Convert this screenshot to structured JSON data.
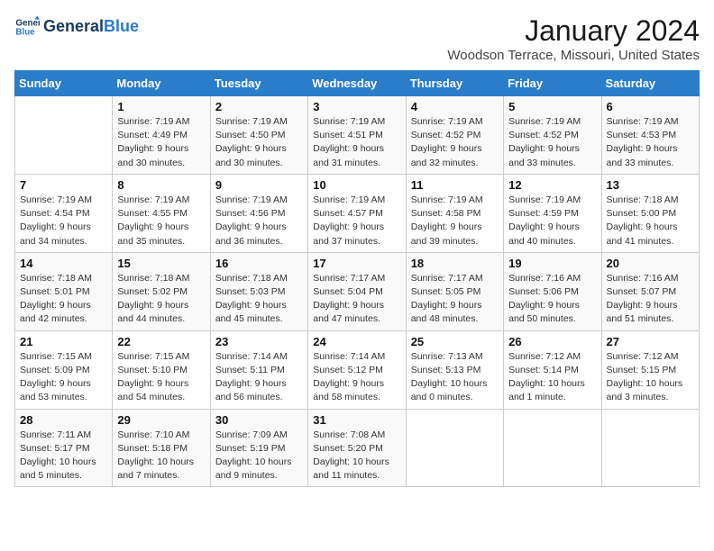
{
  "logo": {
    "text_general": "General",
    "text_blue": "Blue"
  },
  "header": {
    "title": "January 2024",
    "subtitle": "Woodson Terrace, Missouri, United States"
  },
  "columns": [
    "Sunday",
    "Monday",
    "Tuesday",
    "Wednesday",
    "Thursday",
    "Friday",
    "Saturday"
  ],
  "weeks": [
    [
      {
        "day": "",
        "info": ""
      },
      {
        "day": "1",
        "info": "Sunrise: 7:19 AM\nSunset: 4:49 PM\nDaylight: 9 hours\nand 30 minutes."
      },
      {
        "day": "2",
        "info": "Sunrise: 7:19 AM\nSunset: 4:50 PM\nDaylight: 9 hours\nand 30 minutes."
      },
      {
        "day": "3",
        "info": "Sunrise: 7:19 AM\nSunset: 4:51 PM\nDaylight: 9 hours\nand 31 minutes."
      },
      {
        "day": "4",
        "info": "Sunrise: 7:19 AM\nSunset: 4:52 PM\nDaylight: 9 hours\nand 32 minutes."
      },
      {
        "day": "5",
        "info": "Sunrise: 7:19 AM\nSunset: 4:52 PM\nDaylight: 9 hours\nand 33 minutes."
      },
      {
        "day": "6",
        "info": "Sunrise: 7:19 AM\nSunset: 4:53 PM\nDaylight: 9 hours\nand 33 minutes."
      }
    ],
    [
      {
        "day": "7",
        "info": "Sunrise: 7:19 AM\nSunset: 4:54 PM\nDaylight: 9 hours\nand 34 minutes."
      },
      {
        "day": "8",
        "info": "Sunrise: 7:19 AM\nSunset: 4:55 PM\nDaylight: 9 hours\nand 35 minutes."
      },
      {
        "day": "9",
        "info": "Sunrise: 7:19 AM\nSunset: 4:56 PM\nDaylight: 9 hours\nand 36 minutes."
      },
      {
        "day": "10",
        "info": "Sunrise: 7:19 AM\nSunset: 4:57 PM\nDaylight: 9 hours\nand 37 minutes."
      },
      {
        "day": "11",
        "info": "Sunrise: 7:19 AM\nSunset: 4:58 PM\nDaylight: 9 hours\nand 39 minutes."
      },
      {
        "day": "12",
        "info": "Sunrise: 7:19 AM\nSunset: 4:59 PM\nDaylight: 9 hours\nand 40 minutes."
      },
      {
        "day": "13",
        "info": "Sunrise: 7:18 AM\nSunset: 5:00 PM\nDaylight: 9 hours\nand 41 minutes."
      }
    ],
    [
      {
        "day": "14",
        "info": "Sunrise: 7:18 AM\nSunset: 5:01 PM\nDaylight: 9 hours\nand 42 minutes."
      },
      {
        "day": "15",
        "info": "Sunrise: 7:18 AM\nSunset: 5:02 PM\nDaylight: 9 hours\nand 44 minutes."
      },
      {
        "day": "16",
        "info": "Sunrise: 7:18 AM\nSunset: 5:03 PM\nDaylight: 9 hours\nand 45 minutes."
      },
      {
        "day": "17",
        "info": "Sunrise: 7:17 AM\nSunset: 5:04 PM\nDaylight: 9 hours\nand 47 minutes."
      },
      {
        "day": "18",
        "info": "Sunrise: 7:17 AM\nSunset: 5:05 PM\nDaylight: 9 hours\nand 48 minutes."
      },
      {
        "day": "19",
        "info": "Sunrise: 7:16 AM\nSunset: 5:06 PM\nDaylight: 9 hours\nand 50 minutes."
      },
      {
        "day": "20",
        "info": "Sunrise: 7:16 AM\nSunset: 5:07 PM\nDaylight: 9 hours\nand 51 minutes."
      }
    ],
    [
      {
        "day": "21",
        "info": "Sunrise: 7:15 AM\nSunset: 5:09 PM\nDaylight: 9 hours\nand 53 minutes."
      },
      {
        "day": "22",
        "info": "Sunrise: 7:15 AM\nSunset: 5:10 PM\nDaylight: 9 hours\nand 54 minutes."
      },
      {
        "day": "23",
        "info": "Sunrise: 7:14 AM\nSunset: 5:11 PM\nDaylight: 9 hours\nand 56 minutes."
      },
      {
        "day": "24",
        "info": "Sunrise: 7:14 AM\nSunset: 5:12 PM\nDaylight: 9 hours\nand 58 minutes."
      },
      {
        "day": "25",
        "info": "Sunrise: 7:13 AM\nSunset: 5:13 PM\nDaylight: 10 hours\nand 0 minutes."
      },
      {
        "day": "26",
        "info": "Sunrise: 7:12 AM\nSunset: 5:14 PM\nDaylight: 10 hours\nand 1 minute."
      },
      {
        "day": "27",
        "info": "Sunrise: 7:12 AM\nSunset: 5:15 PM\nDaylight: 10 hours\nand 3 minutes."
      }
    ],
    [
      {
        "day": "28",
        "info": "Sunrise: 7:11 AM\nSunset: 5:17 PM\nDaylight: 10 hours\nand 5 minutes."
      },
      {
        "day": "29",
        "info": "Sunrise: 7:10 AM\nSunset: 5:18 PM\nDaylight: 10 hours\nand 7 minutes."
      },
      {
        "day": "30",
        "info": "Sunrise: 7:09 AM\nSunset: 5:19 PM\nDaylight: 10 hours\nand 9 minutes."
      },
      {
        "day": "31",
        "info": "Sunrise: 7:08 AM\nSunset: 5:20 PM\nDaylight: 10 hours\nand 11 minutes."
      },
      {
        "day": "",
        "info": ""
      },
      {
        "day": "",
        "info": ""
      },
      {
        "day": "",
        "info": ""
      }
    ]
  ]
}
